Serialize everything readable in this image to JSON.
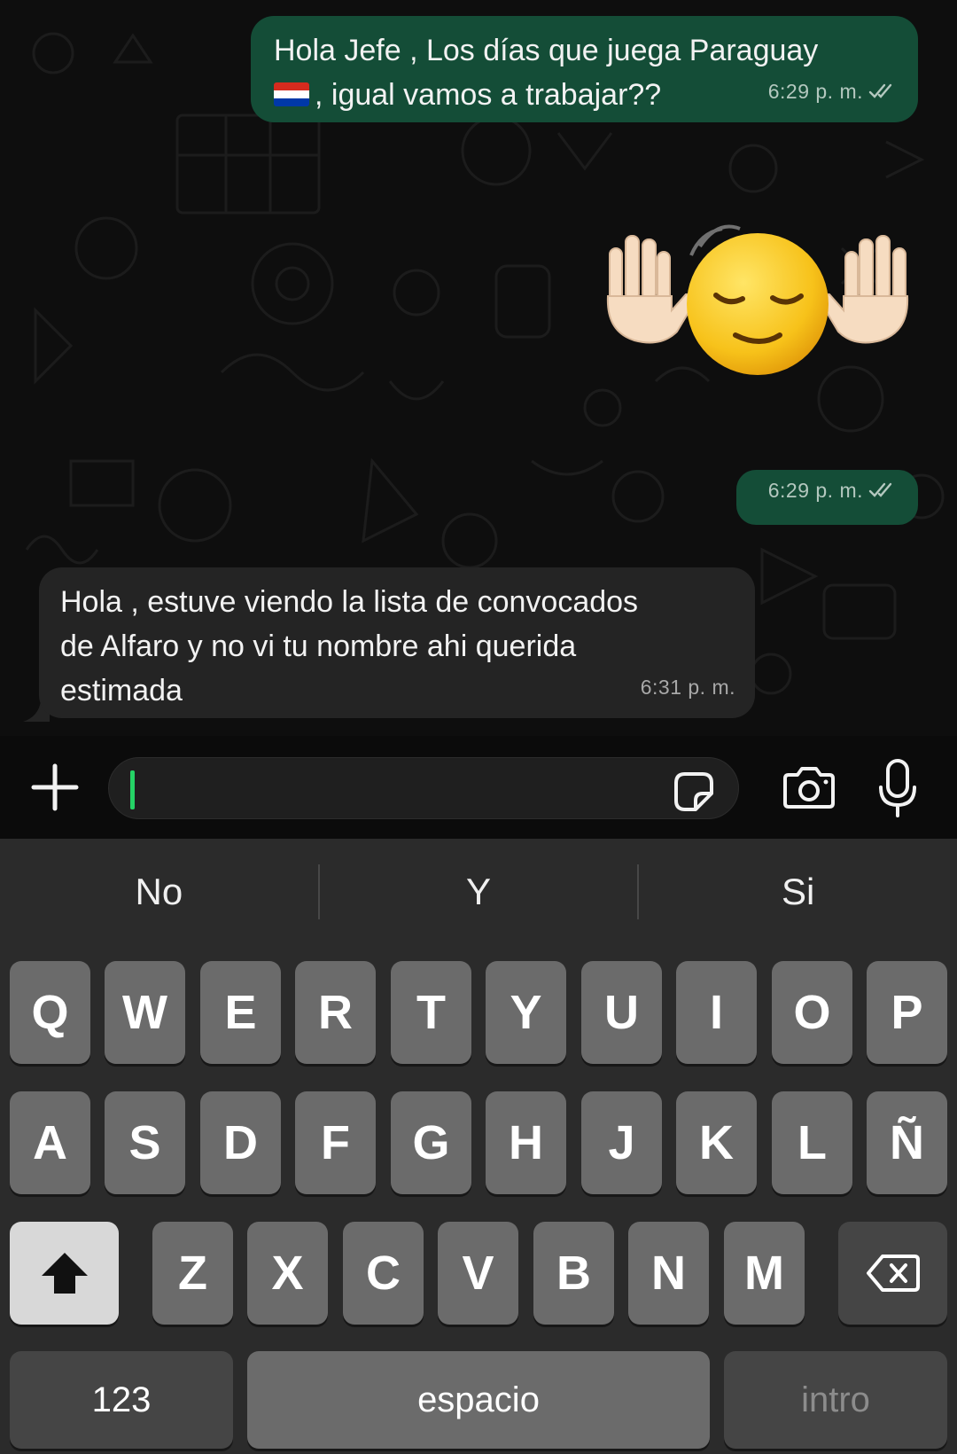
{
  "messages": [
    {
      "direction": "out",
      "text_line1": "Hola Jefe , Los días que juega Paraguay",
      "text_line2": ", igual vamos a trabajar??",
      "time": "6:29 p. m.",
      "status": "read"
    },
    {
      "direction": "out",
      "type": "sticker",
      "sticker": "relieved-face-raised-hands",
      "time": "6:29 p. m.",
      "status": "read"
    },
    {
      "direction": "in",
      "text_line1": "Hola , estuve viendo la lista de convocados",
      "text_line2": "de Alfaro y no vi tu nombre ahi querida",
      "text_line3": "estimada",
      "time": "6:31 p. m."
    }
  ],
  "input": {
    "value": "",
    "placeholder": ""
  },
  "keyboard": {
    "suggestions": [
      "No",
      "Y",
      "Si"
    ],
    "row1": [
      "Q",
      "W",
      "E",
      "R",
      "T",
      "Y",
      "U",
      "I",
      "O",
      "P"
    ],
    "row2": [
      "A",
      "S",
      "D",
      "F",
      "G",
      "H",
      "J",
      "K",
      "L",
      "Ñ"
    ],
    "row3": [
      "Z",
      "X",
      "C",
      "V",
      "B",
      "N",
      "M"
    ],
    "numbers_label": "123",
    "space_label": "espacio",
    "return_label": "intro"
  },
  "colors": {
    "outgoing_bubble": "#144d37",
    "incoming_bubble": "#242424",
    "caret": "#25d366",
    "background": "#0e0e0e"
  }
}
